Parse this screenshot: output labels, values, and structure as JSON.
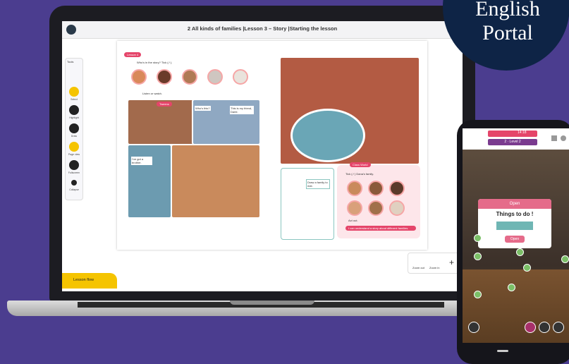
{
  "badge": {
    "line1": "English",
    "line2": "Portal"
  },
  "laptop": {
    "window_title": "2 All kinds of families  |Lesson 3 – Story  |Starting the lesson",
    "tools": {
      "title": "Tools",
      "items": [
        "Select",
        "Highlight",
        "Draw",
        "Page view",
        "Fullscreen",
        "Collapse"
      ]
    },
    "lesson_flow": "Lesson flow",
    "zoom": {
      "out": "Zoom out",
      "in": "Zoom in"
    },
    "book": {
      "lesson_pill": "Lesson 4",
      "q1": "Who's in the story? Tick (✓).",
      "q2": "Listen or watch.",
      "story_title": "Tweens",
      "bubbles": [
        "Who's this?",
        "This is my friend, Darle.",
        "I've got a brother."
      ],
      "right_pill": "Class World",
      "q3": "Tick (✓) Dana's family.",
      "q4": "Act out.",
      "can_do": "I can understand a story about different families.",
      "note": "Draw a family to ride."
    }
  },
  "phone": {
    "status": "14:18",
    "level": "2 · Level 2",
    "card_head": "Open",
    "card_title": "Things to do !",
    "card_button": "Open"
  }
}
